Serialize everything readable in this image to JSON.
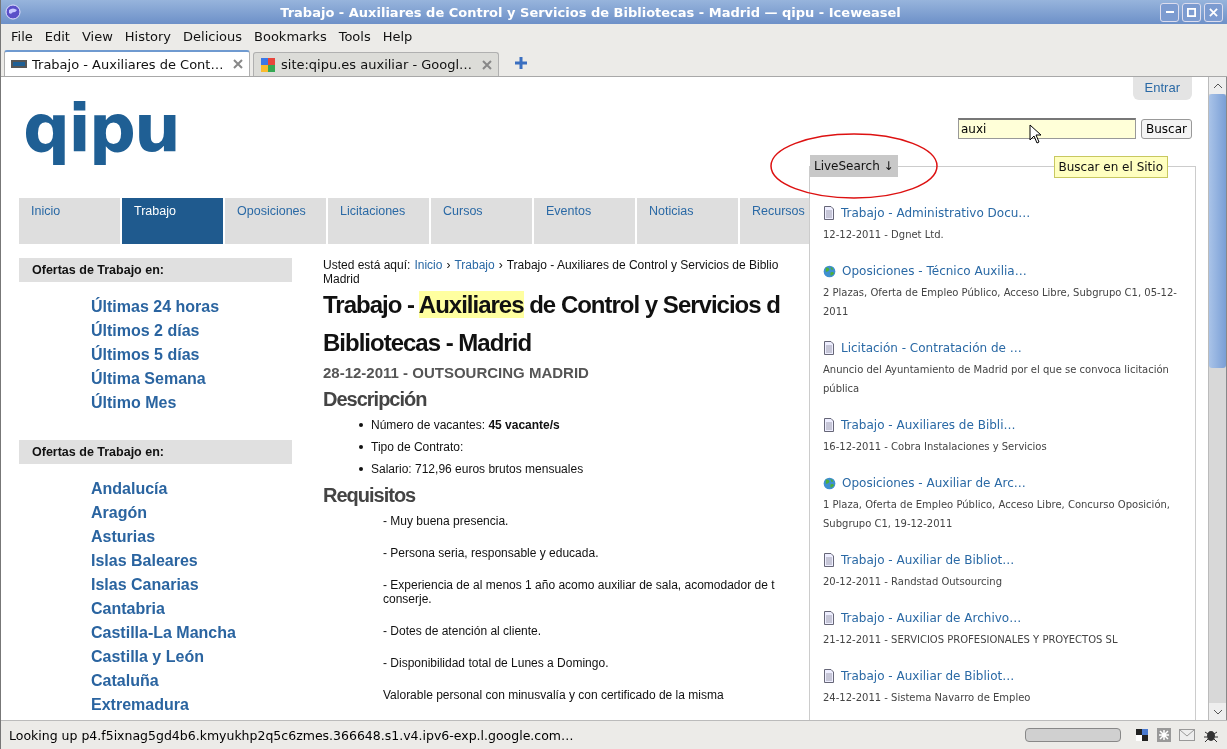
{
  "window": {
    "title": "Trabajo - Auxiliares de Control y Servicios de Bibliotecas - Madrid — qipu - Iceweasel"
  },
  "menu": [
    "File",
    "Edit",
    "View",
    "History",
    "Delicious",
    "Bookmarks",
    "Tools",
    "Help"
  ],
  "tabs": [
    {
      "label": "Trabajo - Auxiliares de Cont…",
      "selected": true
    },
    {
      "label": "site:qipu.es auxiliar - Googl…",
      "selected": false
    }
  ],
  "page": {
    "logo": "qipu",
    "login": "Entrar",
    "search": {
      "value": "auxi",
      "button": "Buscar"
    },
    "nav": [
      {
        "label": "Inicio",
        "selected": false
      },
      {
        "label": "Trabajo",
        "selected": true
      },
      {
        "label": "Oposiciones",
        "selected": false
      },
      {
        "label": "Licitaciones",
        "selected": false
      },
      {
        "label": "Cursos",
        "selected": false
      },
      {
        "label": "Eventos",
        "selected": false
      },
      {
        "label": "Noticias",
        "selected": false
      },
      {
        "label": "Recursos",
        "selected": false
      }
    ],
    "sidebar": [
      {
        "heading": "Ofertas de Trabajo en:",
        "links": [
          "Últimas 24 horas",
          "Últimos 2 días",
          "Últimos 5 días",
          "Última Semana",
          "Último Mes"
        ]
      },
      {
        "heading": "Ofertas de Trabajo en:",
        "links": [
          "Andalucía",
          "Aragón",
          "Asturias",
          "Islas Baleares",
          "Islas Canarias",
          "Cantabria",
          "Castilla-La Mancha",
          "Castilla y León",
          "Cataluña",
          "Extremadura"
        ]
      }
    ],
    "breadcrumb": {
      "prefix": "Usted está aquí:",
      "links": [
        "Inicio",
        "Trabajo"
      ],
      "separators": [
        "›",
        "›"
      ],
      "current": "Trabajo - Auxiliares de Control y Servicios de Biblio",
      "current_continued": "Madrid"
    },
    "title": {
      "before": "Trabajo - ",
      "highlight": "Auxiliares",
      "after": " de Control y Servicios d",
      "line_2": "Bibliotecas - Madrid"
    },
    "subtitle": "28-12-2011 - OUTSOURCING MADRID",
    "description_heading": "Descripción",
    "description": [
      "Número de vacantes: **45 vacante/s**",
      "Tipo de Contrato:",
      "Salario: 712,96 euros brutos mensuales"
    ],
    "requirements_heading": "Requisitos",
    "requirements": [
      [
        "- Muy buena presencia."
      ],
      [
        "- Persona seria, responsable y educada."
      ],
      [
        "- Experiencia de al menos 1 año acomo auxiliar de sala, acomodador de t",
        "conserje."
      ],
      [
        "- Dotes de atención al cliente."
      ],
      [
        "- Disponibilidad total de Lunes a Domingo."
      ],
      [
        "Valorable personal con minusvalía y con certificado de la misma"
      ]
    ],
    "livesearch": {
      "label": "LiveSearch ↓",
      "site_label": "Buscar en el Sitio",
      "results": [
        {
          "kind": "page",
          "title": "Trabajo - Administrativo Docu…",
          "detail": "12-12-2011 - Dgnet Ltd."
        },
        {
          "kind": "globe",
          "title": "Oposiciones - Técnico Auxilia…",
          "detail": "2 Plazas, Oferta de Empleo Público, Acceso Libre, Subgrupo C1, 05-12-2011"
        },
        {
          "kind": "page",
          "title": "Licitación - Contratación de …",
          "detail": "Anuncio del Ayuntamiento de Madrid por el que se convoca licitación pública"
        },
        {
          "kind": "page",
          "title": "Trabajo - Auxiliares de Bibli…",
          "detail": "16-12-2011 - Cobra Instalaciones y Servicios"
        },
        {
          "kind": "globe",
          "title": "Oposiciones - Auxiliar de Arc…",
          "detail": "1 Plaza, Oferta de Empleo Público, Acceso Libre, Concurso Oposición, Subgrupo C1, 19-12-2011"
        },
        {
          "kind": "page",
          "title": "Trabajo - Auxiliar de Bibliot…",
          "detail": "20-12-2011 - Randstad Outsourcing"
        },
        {
          "kind": "page",
          "title": "Trabajo - Auxiliar de Archivo…",
          "detail": "21-12-2011 - SERVICIOS PROFESIONALES Y PROYECTOS SL"
        },
        {
          "kind": "page",
          "title": "Trabajo - Auxiliar de Bibliot…",
          "detail": "24-12-2011 - Sistema Navarro de Empleo"
        }
      ]
    }
  },
  "progress": {
    "level": 0
  },
  "status_bar": "Looking up p4.f5ixnag5gd4b6.kmyukhp2q5c6zmes.366648.s1.v4.ipv6-exp.l.google.com…"
}
